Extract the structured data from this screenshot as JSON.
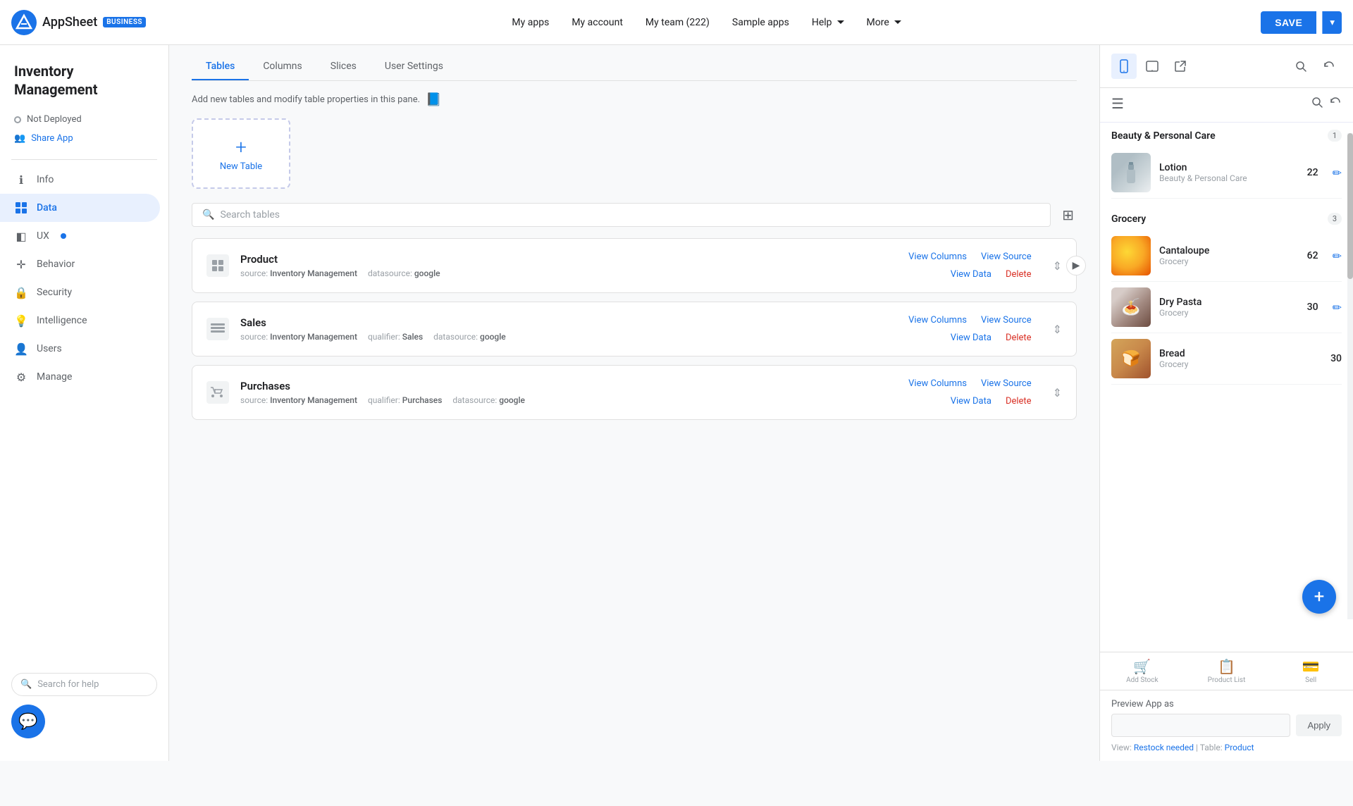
{
  "topNav": {
    "logoText": "AppSheet",
    "bizBadge": "BUSINESS",
    "links": [
      {
        "label": "My apps",
        "id": "my-apps"
      },
      {
        "label": "My account",
        "id": "my-account"
      },
      {
        "label": "My team (222)",
        "id": "my-team"
      },
      {
        "label": "Sample apps",
        "id": "sample-apps"
      },
      {
        "label": "Help",
        "id": "help",
        "dropdown": true
      },
      {
        "label": "More",
        "id": "more",
        "dropdown": true
      }
    ],
    "saveLabel": "SAVE"
  },
  "sidebar": {
    "appTitle": "Inventory Management",
    "notDeployed": "Not Deployed",
    "shareApp": "Share App",
    "navItems": [
      {
        "id": "info",
        "label": "Info",
        "icon": "ℹ"
      },
      {
        "id": "data",
        "label": "Data",
        "icon": "⊞",
        "active": true
      },
      {
        "id": "ux",
        "label": "UX",
        "icon": "◧",
        "dot": true
      },
      {
        "id": "behavior",
        "label": "Behavior",
        "icon": "+"
      },
      {
        "id": "security",
        "label": "Security",
        "icon": "🔒"
      },
      {
        "id": "intelligence",
        "label": "Intelligence",
        "icon": "💡"
      },
      {
        "id": "users",
        "label": "Users",
        "icon": "👤"
      },
      {
        "id": "manage",
        "label": "Manage",
        "icon": "⚙"
      }
    ],
    "searchHelp": "Search for help"
  },
  "tabs": [
    {
      "label": "Tables",
      "active": true
    },
    {
      "label": "Columns"
    },
    {
      "label": "Slices"
    },
    {
      "label": "User Settings"
    }
  ],
  "paneDesc": "Add new tables and modify table properties in this pane.",
  "newTable": "New Table",
  "searchPlaceholder": "Search tables",
  "tables": [
    {
      "id": "product",
      "name": "Product",
      "source": "Inventory Management",
      "datasource": "google",
      "qualifier": null,
      "actions": [
        "View Columns",
        "View Source",
        "View Data",
        "Delete"
      ]
    },
    {
      "id": "sales",
      "name": "Sales",
      "source": "Inventory Management",
      "datasource": "google",
      "qualifier": "Sales",
      "actions": [
        "View Columns",
        "View Source",
        "View Data",
        "Delete"
      ]
    },
    {
      "id": "purchases",
      "name": "Purchases",
      "source": "Inventory Management",
      "datasource": "google",
      "qualifier": "Purchases",
      "actions": [
        "View Columns",
        "View Source",
        "View Data",
        "Delete"
      ]
    }
  ],
  "preview": {
    "categories": [
      {
        "name": "Beauty & Personal Care",
        "count": 1,
        "items": [
          {
            "name": "Lotion",
            "category": "Beauty & Personal Care",
            "qty": 22,
            "imgType": "lotion"
          }
        ]
      },
      {
        "name": "Grocery",
        "count": 3,
        "items": [
          {
            "name": "Cantaloupe",
            "category": "Grocery",
            "qty": 62,
            "imgType": "cantaloupe"
          },
          {
            "name": "Dry Pasta",
            "category": "Grocery",
            "qty": 30,
            "imgType": "pasta"
          },
          {
            "name": "Bread",
            "category": "Grocery",
            "qty": 30,
            "imgType": "bread"
          }
        ]
      }
    ],
    "bottomNav": [
      {
        "label": "Add Stock",
        "icon": "🛒",
        "active": false
      },
      {
        "label": "Product List",
        "icon": "📋",
        "active": false
      },
      {
        "label": "Sell",
        "icon": "💳",
        "active": false
      }
    ],
    "previewAsLabel": "Preview App as",
    "previewAsPlaceholder": "",
    "applyLabel": "Apply",
    "viewLabel": "View:",
    "viewLink": "Restock needed",
    "tableLabel": "Table:",
    "tableLink": "Product"
  }
}
